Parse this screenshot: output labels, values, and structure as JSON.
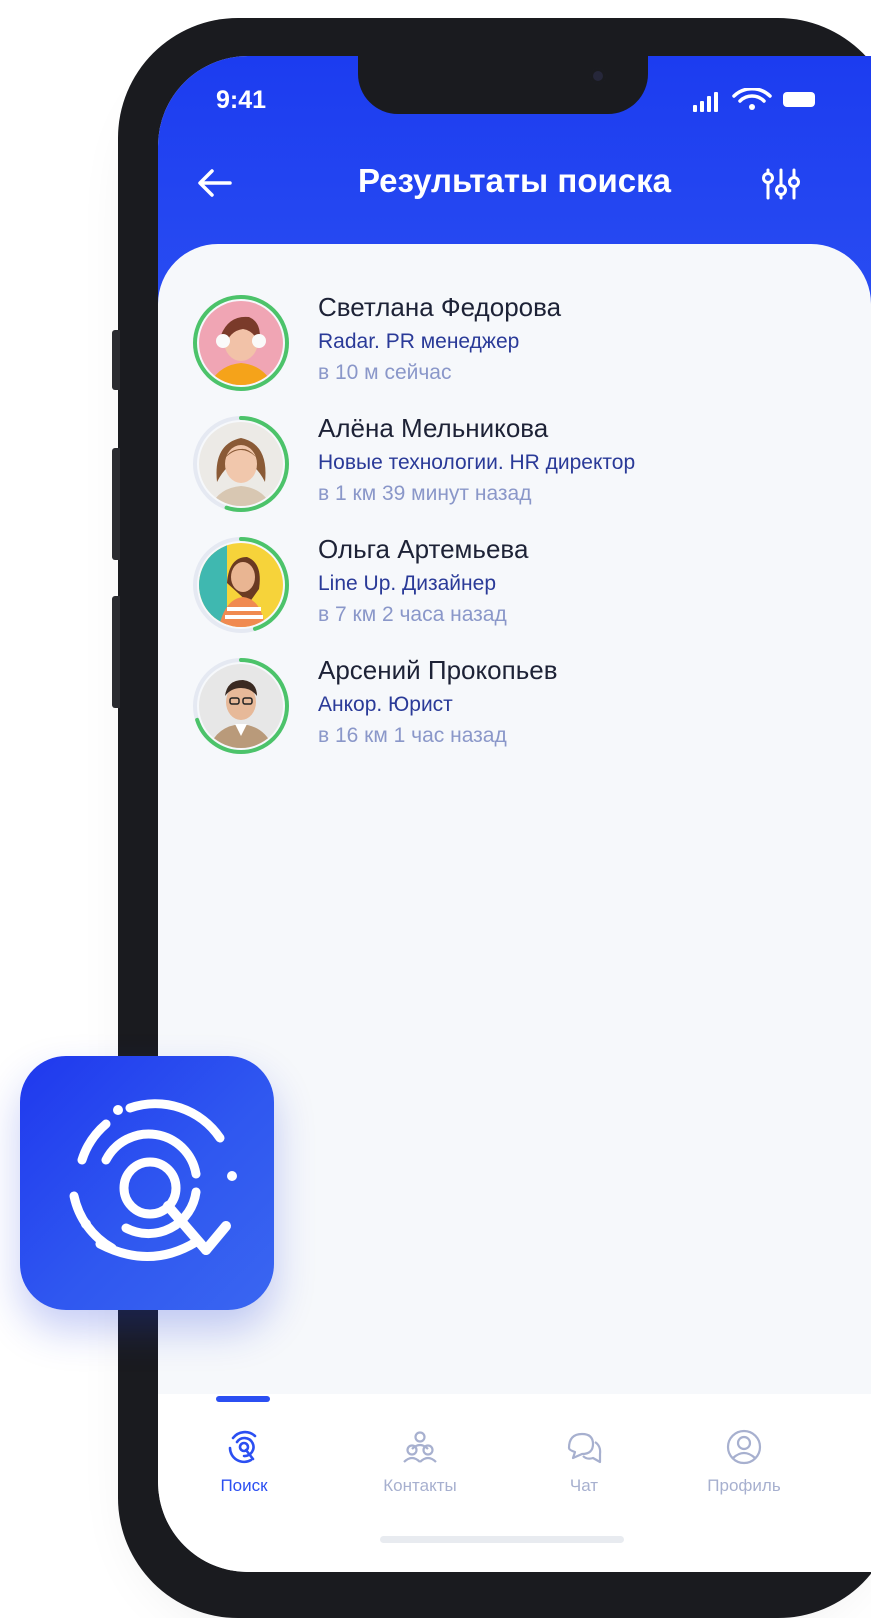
{
  "status_bar": {
    "time": "9:41"
  },
  "header": {
    "title": "Результаты поиска",
    "back_icon": "arrow-left-icon",
    "filter_icon": "sliders-icon"
  },
  "results": [
    {
      "name": "Светлана Федорова",
      "company": "Radar. PR менеджер",
      "distance": "в 10 м сейчас",
      "ring_fraction": 1.0
    },
    {
      "name": "Алёна Мельникова",
      "company": "Новые технологии. HR директор",
      "distance": "в 1 км 39 минут назад",
      "ring_fraction": 0.55
    },
    {
      "name": "Ольга Артемьева",
      "company": "Line Up. Дизайнер",
      "distance": "в 7 км 2 часа назад",
      "ring_fraction": 0.45
    },
    {
      "name": "Арсений Прокопьев",
      "company": "Анкор. Юрист",
      "distance": "в 16 км 1 час назад",
      "ring_fraction": 0.7
    }
  ],
  "tabbar": {
    "tabs": [
      {
        "label": "Поиск",
        "icon": "radar-search-icon",
        "active": true
      },
      {
        "label": "Контакты",
        "icon": "contacts-icon",
        "active": false
      },
      {
        "label": "Чат",
        "icon": "chat-icon",
        "active": false
      },
      {
        "label": "Профиль",
        "icon": "profile-icon",
        "active": false
      }
    ]
  },
  "colors": {
    "accent": "#2b4ff2",
    "ring_green": "#4cc36a",
    "ring_track": "#e5e9f2",
    "text_primary": "#1d2236",
    "text_company": "#2a3a98",
    "text_muted": "#8a97c9",
    "tab_inactive": "#a7b0cf"
  },
  "app_icon": {
    "icon": "radar-logo-icon"
  }
}
